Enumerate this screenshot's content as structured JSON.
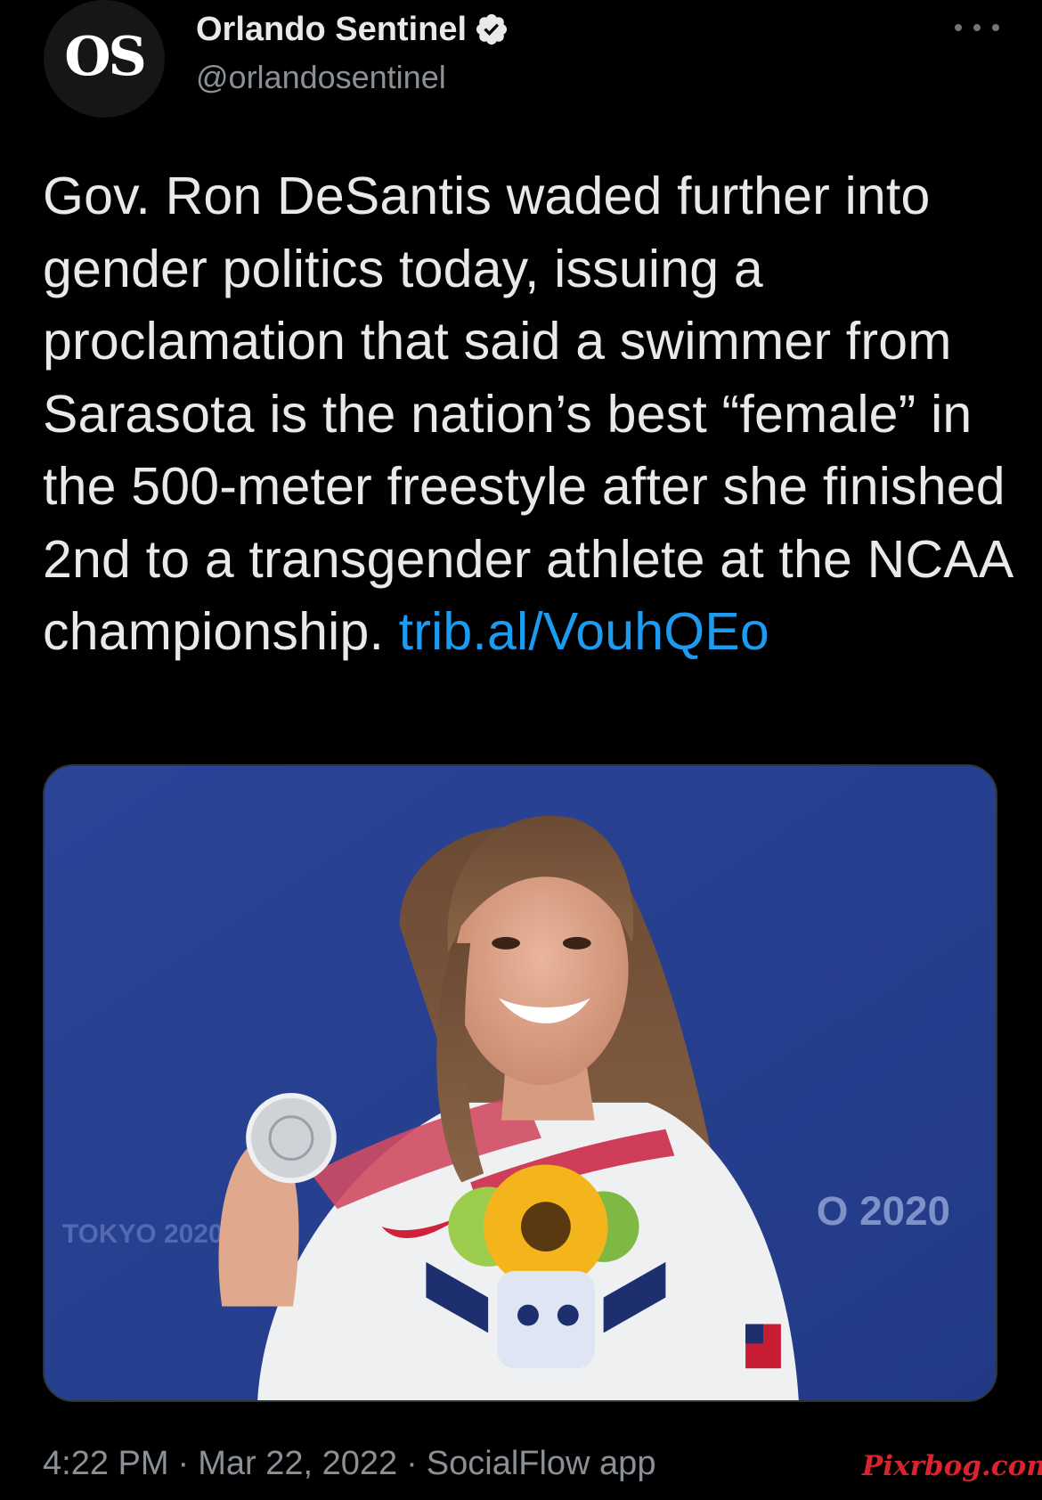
{
  "author": {
    "avatar_text": "OS",
    "display_name": "Orlando Sentinel",
    "handle": "@orlandosentinel",
    "verified": true
  },
  "tweet": {
    "text": "Gov. Ron DeSantis waded further into gender politics today, issuing a proclamation that said a swimmer from Sarasota is the nation’s best “female” in the 500-meter freestyle after she finished 2nd to a transgender athlete at the NCAA championship.",
    "link": "trib.al/VouhQEo"
  },
  "media": {
    "background_text_left": "TOKYO 2020",
    "background_text_right": "O 2020"
  },
  "footer": {
    "time": "4:22 PM",
    "date": "Mar 22, 2022",
    "source": "SocialFlow app",
    "separator": "·"
  },
  "watermark": "Pixrbog.com",
  "colors": {
    "background": "#000000",
    "text": "#e7e9ea",
    "secondary_text": "#8b9096",
    "link": "#1d9bf0",
    "watermark": "#d9232e"
  }
}
